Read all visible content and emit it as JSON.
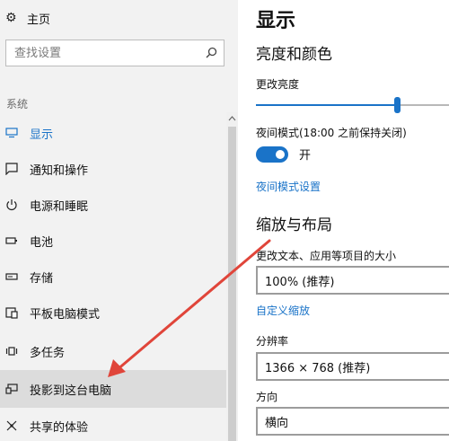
{
  "nav": {
    "home_label": "主页",
    "search_placeholder": "查找设置",
    "section_label": "系统",
    "items": [
      {
        "label": "显示",
        "icon": "monitor-icon",
        "active": true
      },
      {
        "label": "通知和操作",
        "icon": "notification-icon"
      },
      {
        "label": "电源和睡眠",
        "icon": "power-icon"
      },
      {
        "label": "电池",
        "icon": "battery-icon"
      },
      {
        "label": "存储",
        "icon": "storage-icon"
      },
      {
        "label": "平板电脑模式",
        "icon": "tablet-mode-icon"
      },
      {
        "label": "多任务",
        "icon": "multitask-icon"
      },
      {
        "label": "投影到这台电脑",
        "icon": "project-icon",
        "selected": true
      },
      {
        "label": "共享的体验",
        "icon": "shared-experience-icon"
      }
    ]
  },
  "main": {
    "page_title": "显示",
    "brightness_heading": "亮度和颜色",
    "brightness_label": "更改亮度",
    "brightness_level": 0.73,
    "night_mode_label": "夜间模式(18:00 之前保持关闭)",
    "night_mode_state": "开",
    "night_mode_link": "夜间模式设置",
    "scale_heading": "缩放与布局",
    "scale_label": "更改文本、应用等项目的大小",
    "scale_value": "100% (推荐)",
    "custom_scale_link": "自定义缩放",
    "resolution_label": "分辨率",
    "resolution_value": "1366 × 768 (推荐)",
    "orientation_label": "方向",
    "orientation_value": "横向"
  },
  "colors": {
    "accent": "#1a73c8",
    "nav_bg": "#f2f2f2",
    "selected_bg": "#dcdcdc",
    "arrow": "#e0453a"
  }
}
